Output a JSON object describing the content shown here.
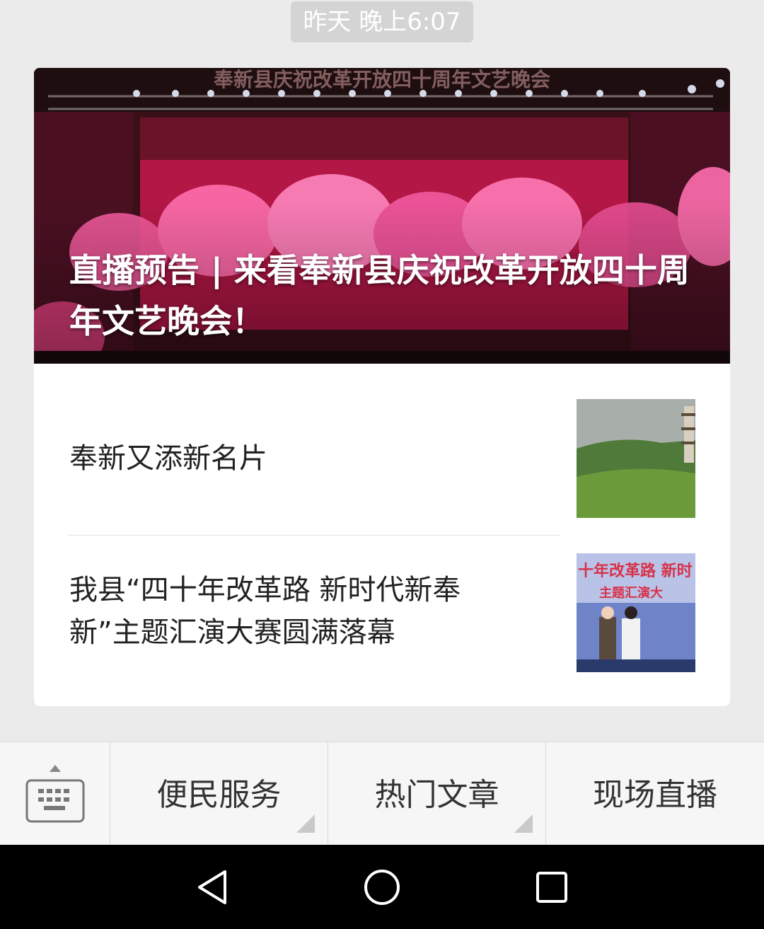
{
  "timestamp": "昨天 晚上6:07",
  "hero": {
    "title": "直播预告 | 来看奉新县庆祝改革开放四十周年文艺晚会！",
    "banner_text": "奉新县庆祝改革开放四十周年文艺晚会"
  },
  "articles": [
    {
      "title": "奉新又添新名片",
      "thumb": "pagoda-landscape"
    },
    {
      "title": "我县“四十年改革路 新时代新奉新”主题汇演大赛圆满落幕",
      "thumb": "award-stage",
      "thumb_text": [
        "十年改革路 新时",
        "主题汇演大"
      ]
    }
  ],
  "menu": {
    "items": [
      {
        "label": "便民服务",
        "has_submenu": true
      },
      {
        "label": "热门文章",
        "has_submenu": true
      },
      {
        "label": "现场直播",
        "has_submenu": false
      }
    ]
  },
  "icons": {
    "keyboard": "keyboard-icon",
    "back": "back-icon",
    "home": "home-icon",
    "recents": "recents-icon"
  },
  "colors": {
    "background": "#ebebeb",
    "card": "#ffffff",
    "menu_bar": "#f6f6f6",
    "nav_bar": "#000000"
  }
}
